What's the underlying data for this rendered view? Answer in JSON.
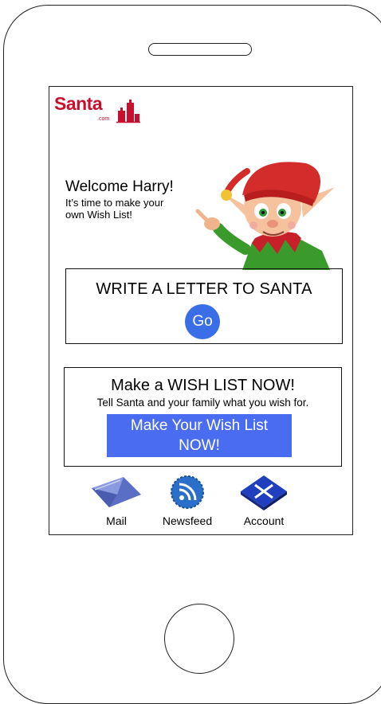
{
  "app": {
    "logo_text": "Santa",
    "logo_sub": ".com"
  },
  "welcome": {
    "title": "Welcome Harry!",
    "subtitle_line1": "It’s time to make your",
    "subtitle_line2": "own Wish List!"
  },
  "letter": {
    "title": "WRITE A LETTER TO SANTA",
    "go_label": "Go"
  },
  "wishlist": {
    "title": "Make a WISH LIST NOW!",
    "subtitle": "Tell Santa and your family what you wish for.",
    "button_line1": "Make Your Wish List",
    "button_line2": "NOW!"
  },
  "nav": {
    "items": [
      {
        "label": "Mail",
        "icon": "mail-icon"
      },
      {
        "label": "Newsfeed",
        "icon": "rss-icon"
      },
      {
        "label": "Account",
        "icon": "account-tools-icon"
      }
    ]
  },
  "colors": {
    "brand_red": "#c8102e",
    "button_blue": "#3a6ee8",
    "wish_button_blue": "#4a6cf0"
  }
}
